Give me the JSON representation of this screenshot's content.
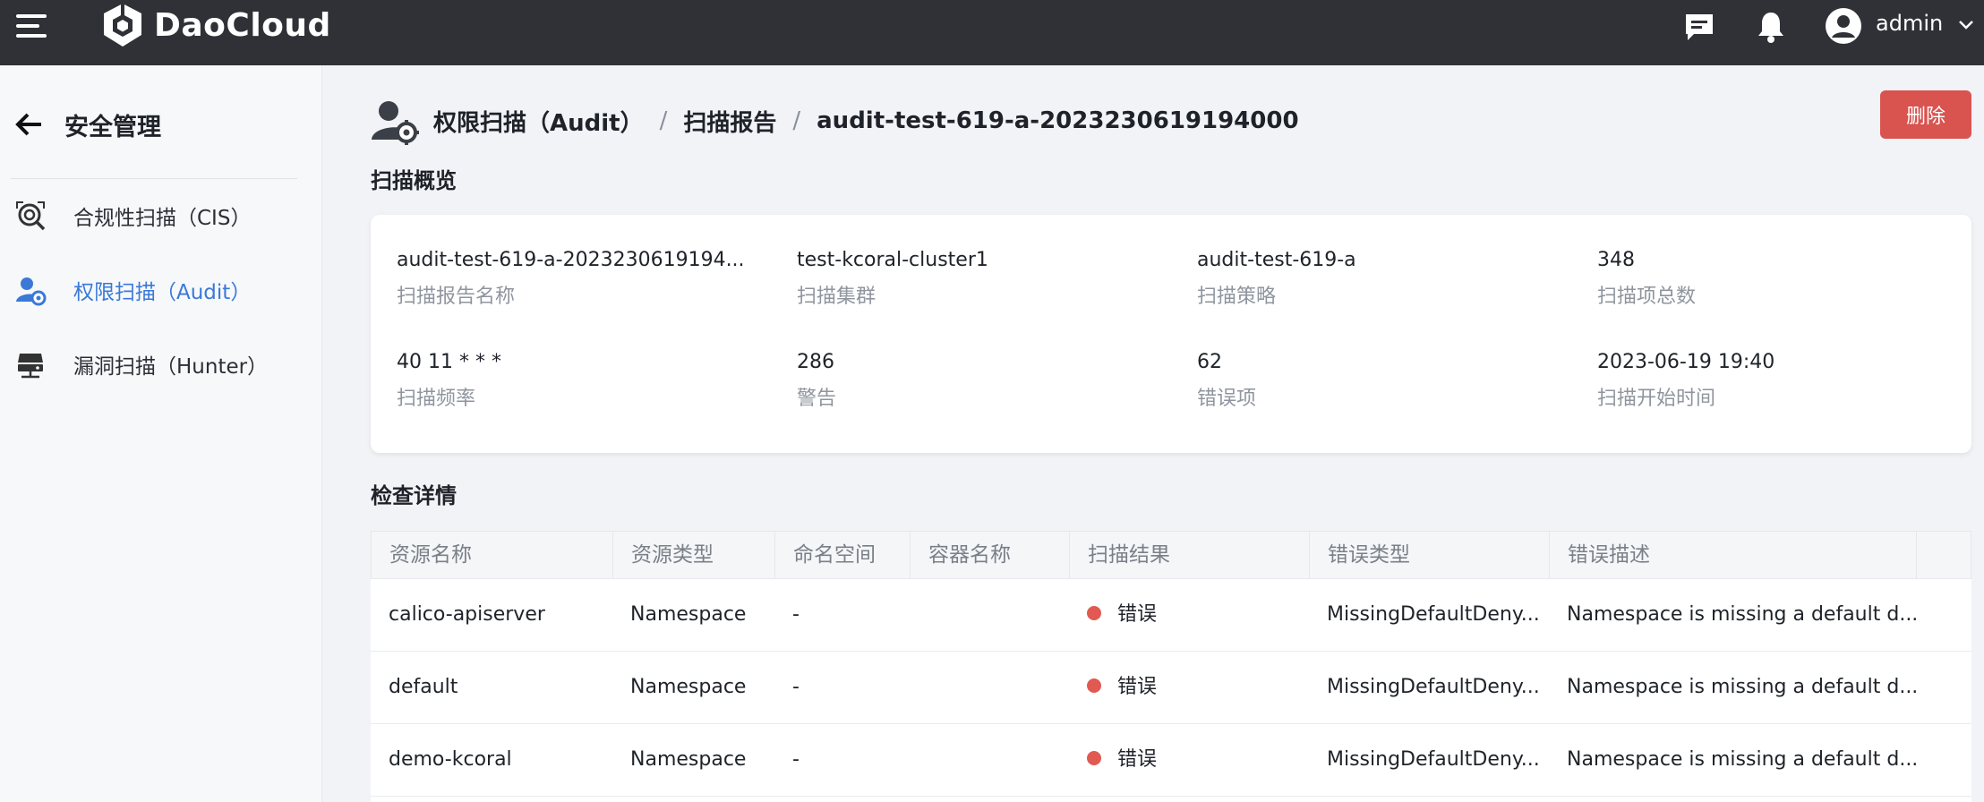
{
  "header": {
    "brand": "DaoCloud",
    "user": "admin"
  },
  "sidebar": {
    "title": "安全管理",
    "items": [
      {
        "label": "合规性扫描（CIS）",
        "icon": "scan-search-icon",
        "active": false
      },
      {
        "label": "权限扫描（Audit）",
        "icon": "user-gear-icon",
        "active": true
      },
      {
        "label": "漏洞扫描（Hunter）",
        "icon": "server-icon",
        "active": false
      }
    ]
  },
  "breadcrumb": {
    "level1": "权限扫描（Audit）",
    "sep": "/",
    "level2": "扫描报告",
    "level3": "audit-test-619-a-2023230619194000"
  },
  "actions": {
    "delete": "删除"
  },
  "overview": {
    "title": "扫描概览",
    "fields": [
      {
        "value": "audit-test-619-a-2023230619194...",
        "label": "扫描报告名称"
      },
      {
        "value": "test-kcoral-cluster1",
        "label": "扫描集群"
      },
      {
        "value": "audit-test-619-a",
        "label": "扫描策略"
      },
      {
        "value": "348",
        "label": "扫描项总数"
      },
      {
        "value": "40 11 * * *",
        "label": "扫描频率"
      },
      {
        "value": "286",
        "label": "警告"
      },
      {
        "value": "62",
        "label": "错误项"
      },
      {
        "value": "2023-06-19 19:40",
        "label": "扫描开始时间"
      }
    ]
  },
  "details": {
    "title": "检查详情",
    "columns": [
      "资源名称",
      "资源类型",
      "命名空间",
      "容器名称",
      "扫描结果",
      "错误类型",
      "错误描述"
    ],
    "rows": [
      {
        "name": "calico-apiserver",
        "type": "Namespace",
        "namespace": "-",
        "container": "",
        "result": "错误",
        "error_type": "MissingDefaultDeny...",
        "error_desc": "Namespace is missing a default d..."
      },
      {
        "name": "default",
        "type": "Namespace",
        "namespace": "-",
        "container": "",
        "result": "错误",
        "error_type": "MissingDefaultDeny...",
        "error_desc": "Namespace is missing a default d..."
      },
      {
        "name": "demo-kcoral",
        "type": "Namespace",
        "namespace": "-",
        "container": "",
        "result": "错误",
        "error_type": "MissingDefaultDeny...",
        "error_desc": "Namespace is missing a default d..."
      }
    ]
  },
  "colors": {
    "error_dot": "#e05a52",
    "active": "#3a79d8",
    "danger": "#d9534f"
  }
}
